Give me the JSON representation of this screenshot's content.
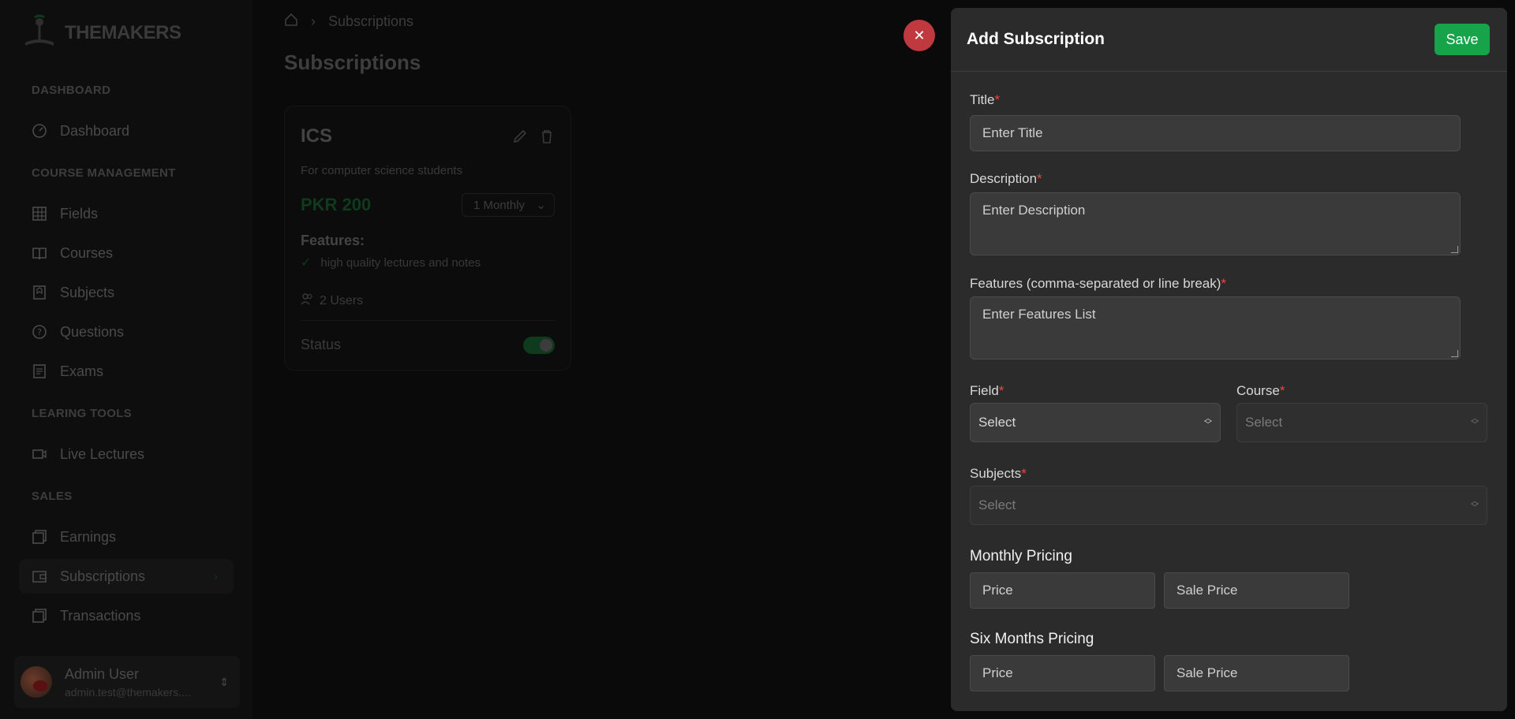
{
  "brand": {
    "logo_text": "THEMAKERS"
  },
  "sidebar": {
    "sections": [
      {
        "label": "DASHBOARD"
      },
      {
        "label": "COURSE MANAGEMENT"
      },
      {
        "label": "LEARING TOOLS"
      },
      {
        "label": "SALES"
      }
    ],
    "items": [
      {
        "label": "Dashboard",
        "icon": "gauge-icon"
      },
      {
        "label": "Fields",
        "icon": "grid-icon"
      },
      {
        "label": "Courses",
        "icon": "book-icon"
      },
      {
        "label": "Subjects",
        "icon": "bookmark-icon"
      },
      {
        "label": "Questions",
        "icon": "help-circle-icon"
      },
      {
        "label": "Exams",
        "icon": "clipboard-icon"
      },
      {
        "label": "Live Lectures",
        "icon": "video-icon"
      },
      {
        "label": "Earnings",
        "icon": "copy-icon"
      },
      {
        "label": "Subscriptions",
        "icon": "wallet-icon"
      },
      {
        "label": "Transactions",
        "icon": "copy-icon"
      }
    ],
    "active_item": "Subscriptions",
    "user": {
      "name": "Admin User",
      "email": "admin.test@themakers...."
    }
  },
  "breadcrumb": {
    "home_icon": "home-icon",
    "current": "Subscriptions"
  },
  "page": {
    "title": "Subscriptions"
  },
  "subscription_card": {
    "title": "ICS",
    "description": "For computer science students",
    "price": "PKR 200",
    "period": "1 Monthly",
    "features_heading": "Features:",
    "features": [
      "high quality lectures and notes"
    ],
    "users": "2 Users",
    "status_label": "Status",
    "status_on": true
  },
  "drawer": {
    "title": "Add Subscription",
    "save_label": "Save",
    "close_icon": "close-icon",
    "fields": {
      "title": {
        "label": "Title",
        "required": "*",
        "placeholder": "Enter Title"
      },
      "description": {
        "label": "Description",
        "required": "*",
        "placeholder": "Enter Description"
      },
      "features": {
        "label": "Features (comma-separated or line break)",
        "required": "*",
        "placeholder": "Enter Features List"
      },
      "field": {
        "label": "Field",
        "required": "*",
        "value": "Select"
      },
      "course": {
        "label": "Course",
        "required": "*",
        "value": "Select"
      },
      "subjects": {
        "label": "Subjects",
        "required": "*",
        "value": "Select"
      }
    },
    "monthly_pricing": {
      "heading": "Monthly Pricing",
      "price_placeholder": "Price",
      "sale_placeholder": "Sale Price"
    },
    "six_months_pricing": {
      "heading": "Six Months Pricing",
      "price_placeholder": "Price",
      "sale_placeholder": "Sale Price"
    }
  },
  "colors": {
    "accent": "#16a34a",
    "close": "#c0393e",
    "required": "#ef4444",
    "drawer_bg": "#2b2b2b"
  }
}
